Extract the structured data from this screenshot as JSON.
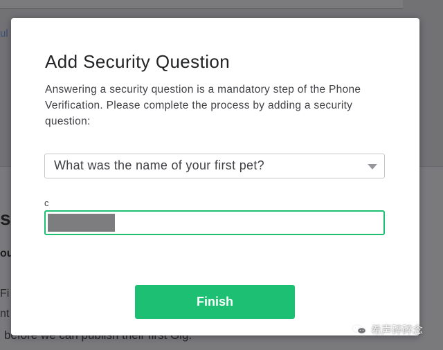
{
  "background": {
    "link_fragment": "ul",
    "heading_fragment": "s",
    "bold_fragment": "ou",
    "line_1_fragment": "Fi",
    "line_2_fragment": "nt",
    "line_3": "before we can publish their first Gig."
  },
  "modal": {
    "title": "Add Security Question",
    "description": "Answering a security question is a mandatory step of the Phone Verification. Please complete the process by adding a security question:",
    "question_select": {
      "selected": "What was the name of your first pet?"
    },
    "answer_label": "c",
    "finish_label": "Finish",
    "accent_color": "#1dbf73"
  },
  "watermark": {
    "icon": "wechat-icon",
    "text": "希声碎碎念"
  }
}
